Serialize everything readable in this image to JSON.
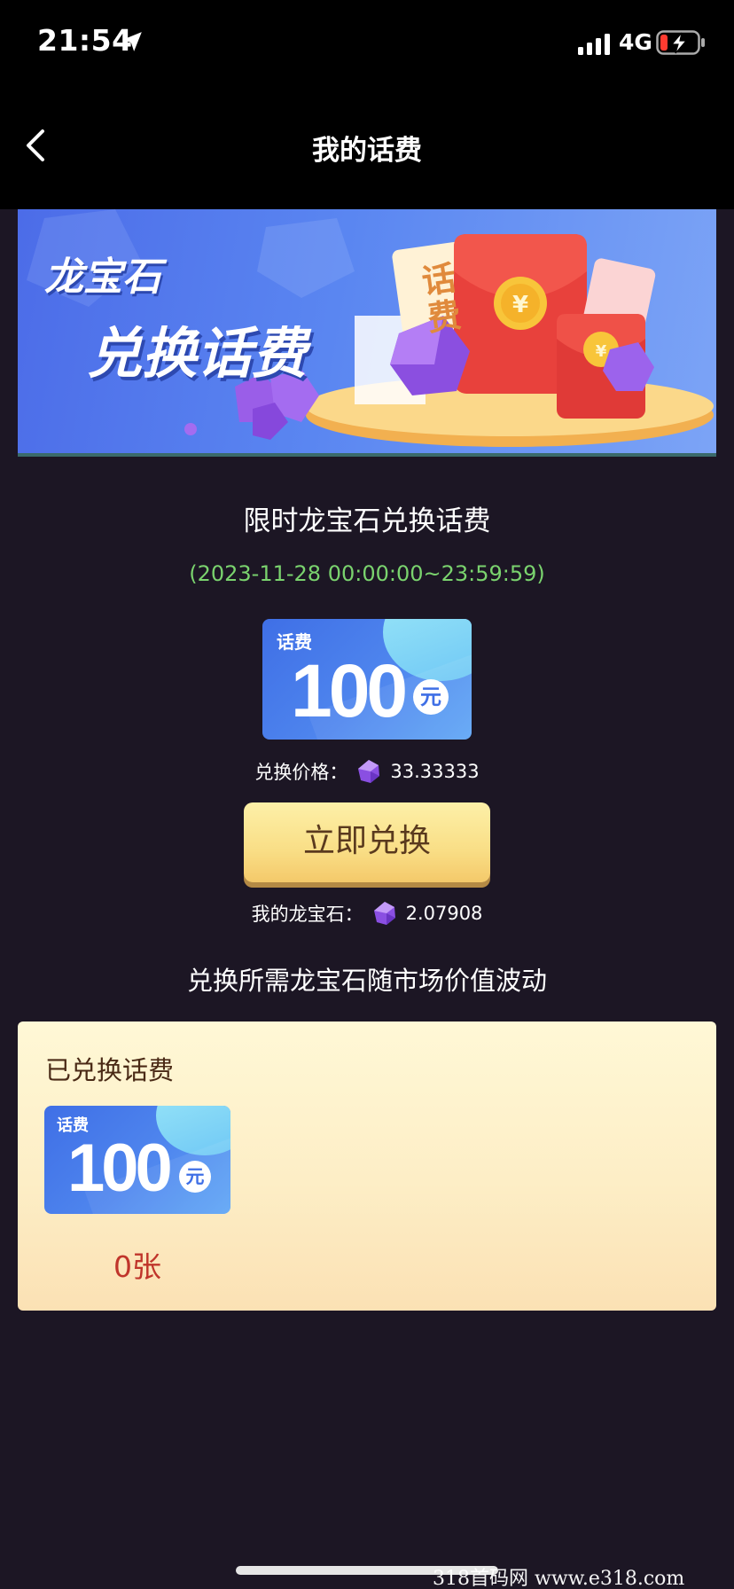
{
  "status_bar": {
    "time": "21:54",
    "network": "4G",
    "icons": [
      "location-arrow-icon",
      "signal-bars-icon",
      "battery-charging-icon"
    ]
  },
  "nav": {
    "title": "我的话费",
    "back_icon": "chevron-left-icon"
  },
  "banner": {
    "line1": "龙宝石",
    "line2": "兑换话费",
    "card_text": "话费"
  },
  "promo": {
    "title": "限时龙宝石兑换话费",
    "period": "(2023-11-28 00:00:00~23:59:59)",
    "voucher": {
      "label": "话费",
      "amount": "100",
      "unit": "元"
    },
    "price_label": "兑换价格：",
    "price_value": "33.33333",
    "button_label": "立即兑换",
    "my_gems_label": "我的龙宝石：",
    "my_gems_value": "2.07908",
    "note": "兑换所需龙宝石随市场价值波动"
  },
  "redeemed": {
    "title": "已兑换话费",
    "voucher": {
      "label": "话费",
      "amount": "100",
      "unit": "元"
    },
    "count": "0张"
  },
  "watermark": "318首码网  www.e318.com",
  "colors": {
    "background": "#1c1624",
    "accent_green": "#7ad36e",
    "button_gold": "#f9de86",
    "count_red": "#c0352b",
    "voucher_blue": "#3f6fe6"
  }
}
